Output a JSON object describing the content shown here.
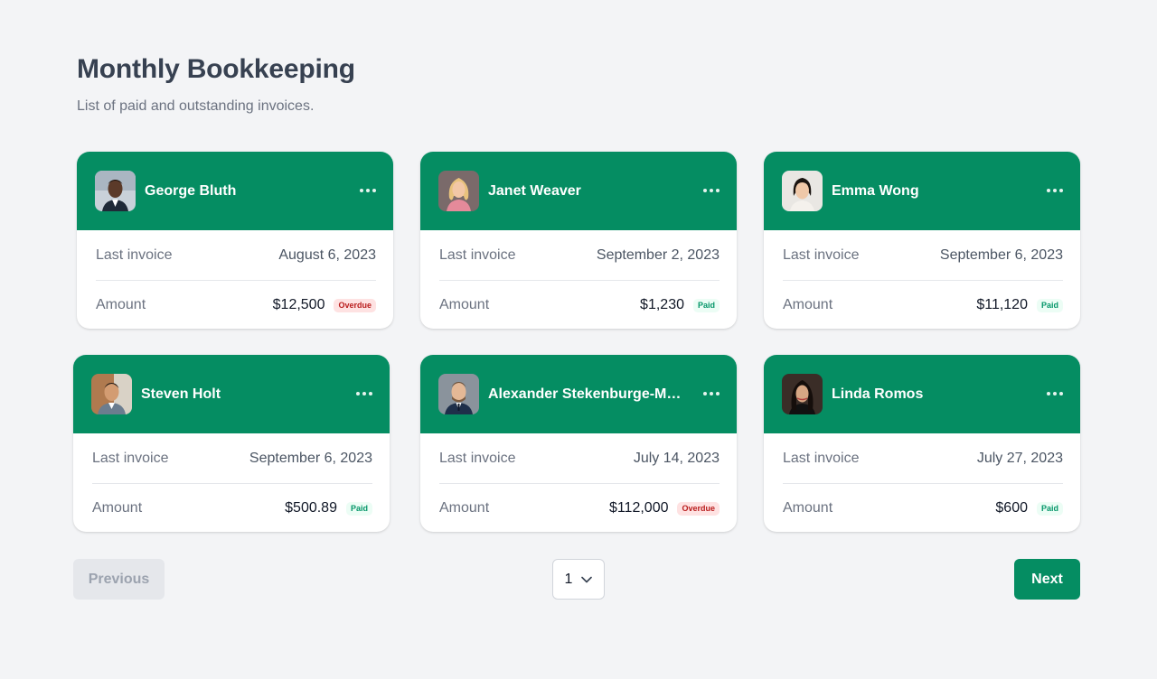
{
  "header": {
    "title": "Monthly Bookkeeping",
    "subtitle": "List of paid and outstanding invoices."
  },
  "labels": {
    "last_invoice": "Last invoice",
    "amount": "Amount"
  },
  "cards": [
    {
      "name": "George Bluth",
      "last_invoice": "August 6, 2023",
      "amount": "$12,500",
      "status": "Overdue",
      "avatar": "person-photo"
    },
    {
      "name": "Janet Weaver",
      "last_invoice": "September 2, 2023",
      "amount": "$1,230",
      "status": "Paid",
      "avatar": "person-photo"
    },
    {
      "name": "Emma Wong",
      "last_invoice": "September 6, 2023",
      "amount": "$11,120",
      "status": "Paid",
      "avatar": "person-photo"
    },
    {
      "name": "Steven Holt",
      "last_invoice": "September 6, 2023",
      "amount": "$500.89",
      "status": "Paid",
      "avatar": "person-photo"
    },
    {
      "name": "Alexander Stekenburge-Mo...",
      "last_invoice": "July 14, 2023",
      "amount": "$112,000",
      "status": "Overdue",
      "avatar": "person-photo"
    },
    {
      "name": "Linda Romos",
      "last_invoice": "July 27, 2023",
      "amount": "$600",
      "status": "Paid",
      "avatar": "person-photo"
    }
  ],
  "pagination": {
    "previous_label": "Previous",
    "next_label": "Next",
    "current_page": "1"
  },
  "colors": {
    "brand": "#058d62",
    "overdue_bg": "#fee2e2",
    "overdue_text": "#b91c1c",
    "paid_bg": "#ecfdf5",
    "paid_text": "#059669",
    "background": "#f3f4f6"
  }
}
